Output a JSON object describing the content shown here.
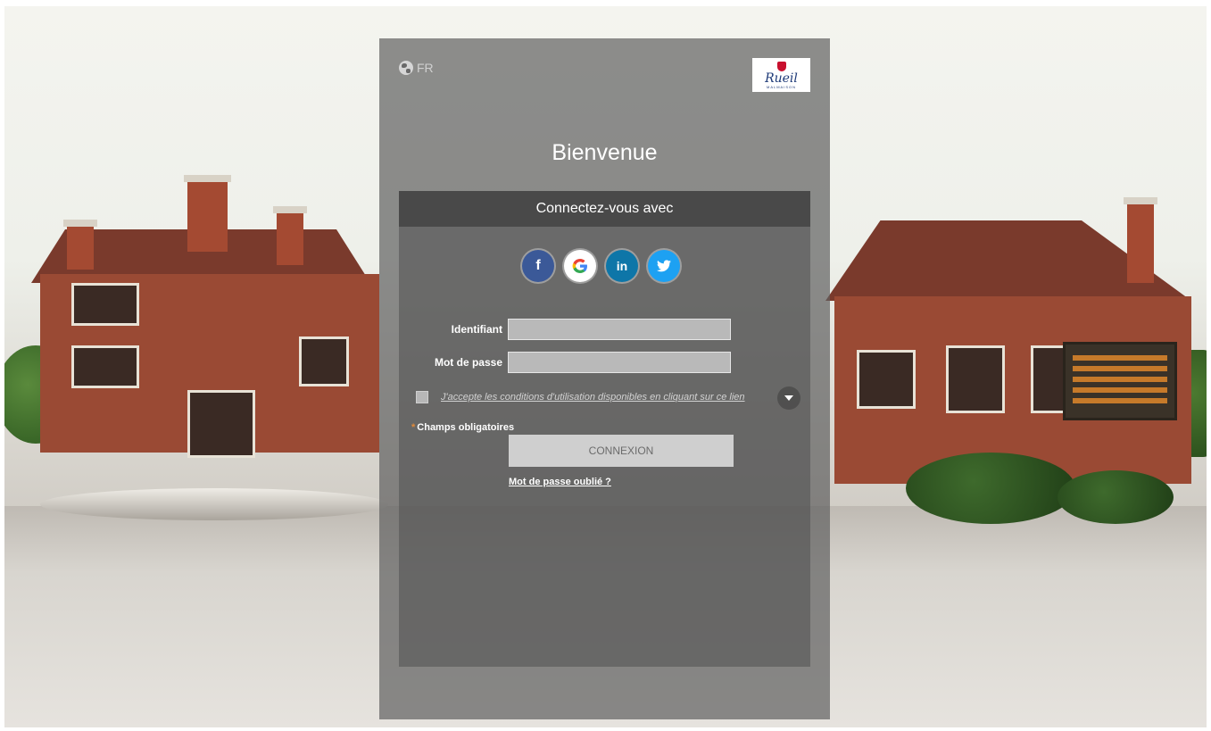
{
  "header": {
    "language": "FR",
    "logo_text": "Rueil",
    "logo_subtext": "MALMAISON",
    "title": "Bienvenue"
  },
  "login_box": {
    "heading": "Connectez-vous avec",
    "social_buttons": [
      {
        "name": "facebook",
        "glyph": "f"
      },
      {
        "name": "google",
        "glyph": "G"
      },
      {
        "name": "linkedin",
        "glyph": "in"
      },
      {
        "name": "twitter",
        "glyph": "twitter-bird"
      }
    ],
    "fields": {
      "username_label": "Identifiant",
      "username_value": "",
      "password_label": "Mot de passe",
      "password_value": ""
    },
    "terms_text": "J'accepte les conditions d'utilisation disponibles en cliquant sur ce lien",
    "required_note": "Champs obligatoires",
    "submit_label": "CONNEXION",
    "forgot_label": "Mot de passe oublié ?"
  },
  "colors": {
    "panel": "#5f5f5f",
    "box_header": "#494949",
    "button": "#cfcfcf",
    "facebook": "#3b5998",
    "linkedin": "#0e76a8",
    "twitter": "#1da1f2",
    "logo_blue": "#1e3a78",
    "logo_red": "#c8102e"
  }
}
